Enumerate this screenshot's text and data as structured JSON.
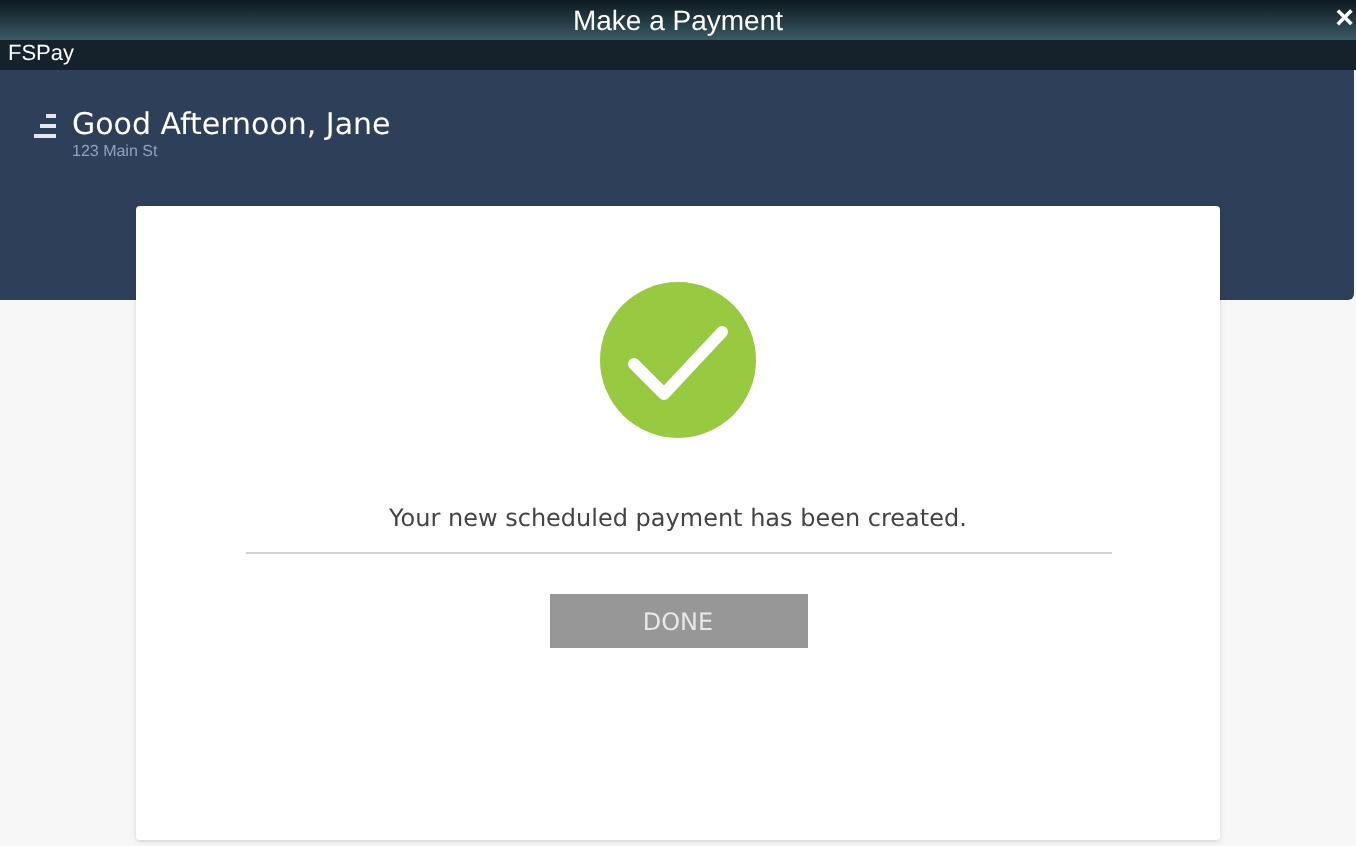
{
  "window": {
    "title": "Make a Payment",
    "close": "×"
  },
  "app_bar": {
    "name": "FSPay"
  },
  "header": {
    "greeting": "Good Afternoon, Jane",
    "address": "123 Main St"
  },
  "confirmation": {
    "message": "Your new scheduled payment has been created.",
    "button": "DONE"
  }
}
